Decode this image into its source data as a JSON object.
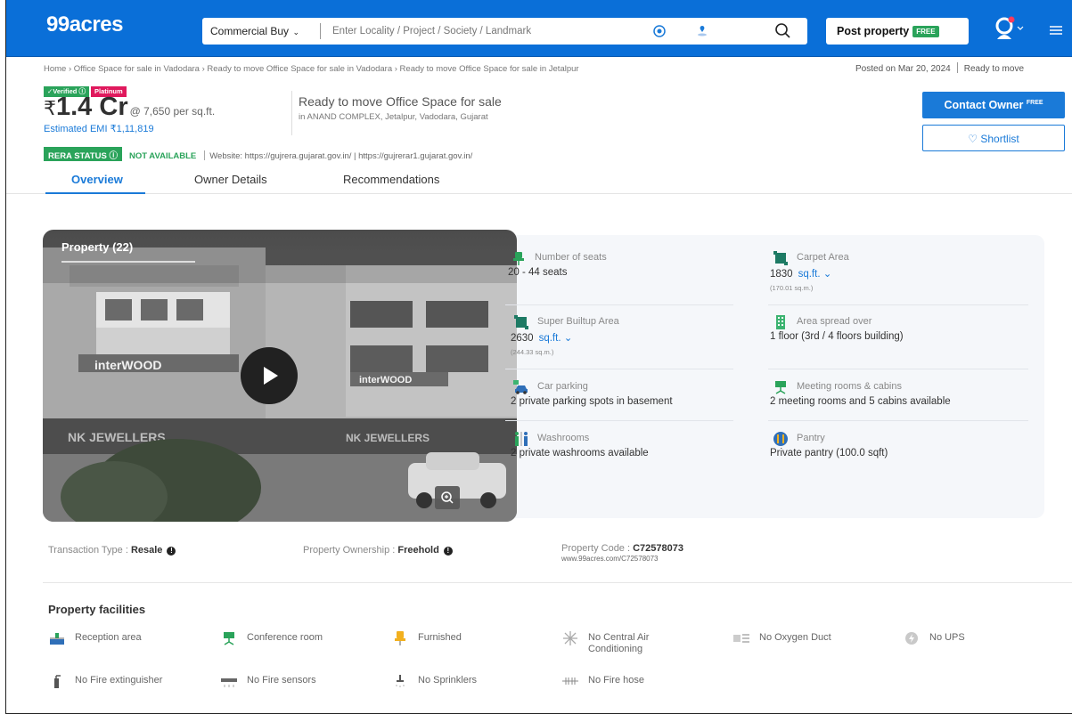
{
  "header": {
    "logo": "99acres",
    "category": "Commercial Buy",
    "search_placeholder": "Enter Locality / Project / Society / Landmark",
    "post_property": "Post property",
    "post_badge": "FREE",
    "brand_color": "#0a6fd8"
  },
  "breadcrumb": "Home › Office Space for sale in Vadodara › Ready to move Office Space for sale in Vadodara › Ready to move Office Space for sale in Jetalpur",
  "posted": {
    "date": "Posted on Mar 20, 2024",
    "status": "Ready to move"
  },
  "badges": {
    "verified": "✓Verified",
    "platinum": "Platinum"
  },
  "price": {
    "currency": "₹",
    "amount": "1.4 Cr",
    "per_sqft": "@ 7,650 per sq.ft.",
    "emi": "Estimated EMI ₹1,11,819"
  },
  "property": {
    "title": "Ready to move Office Space for sale",
    "address": "in ANAND COMPLEX, Jetalpur, Vadodara, Gujarat"
  },
  "actions": {
    "contact": "Contact Owner",
    "contact_badge": "FREE",
    "shortlist": "Shortlist"
  },
  "rera": {
    "label": "RERA STATUS",
    "status": "NOT AVAILABLE",
    "website": "Website: https://gujrera.gujarat.gov.in/",
    "website2": "https://gujrerar1.gujarat.gov.in/"
  },
  "tabs": [
    "Overview",
    "Owner Details",
    "Recommendations"
  ],
  "photo": {
    "title": "Property (22)"
  },
  "features": [
    {
      "label": "Number of seats",
      "value": "20 - 44 seats",
      "icon": "seat-icon"
    },
    {
      "label": "Carpet Area",
      "value": "1830",
      "unit": "sq.ft.",
      "sub": "(170.01 sq.m.)",
      "icon": "area-icon"
    },
    {
      "label": "Super Builtup Area",
      "value": "2630",
      "unit": "sq.ft.",
      "sub": "(244.33 sq.m.)",
      "icon": "builtup-icon"
    },
    {
      "label": "Area spread over",
      "value": "1 floor (3rd / 4 floors building)",
      "icon": "building-icon"
    },
    {
      "label": "Car parking",
      "value": "2 private parking spots in basement",
      "icon": "car-icon"
    },
    {
      "label": "Meeting rooms & cabins",
      "value": "2 meeting rooms and 5 cabins available",
      "icon": "meeting-icon"
    },
    {
      "label": "Washrooms",
      "value": "2 private washrooms available",
      "icon": "washroom-icon"
    },
    {
      "label": "Pantry",
      "value": "Private pantry (100.0 sqft)",
      "icon": "pantry-icon"
    }
  ],
  "transaction": {
    "label": "Transaction Type : ",
    "value": "Resale"
  },
  "ownership": {
    "label": "Property Ownership : ",
    "value": "Freehold"
  },
  "code": {
    "label": "Property Code : ",
    "value": "C72578073",
    "url": "www.99acres.com/C72578073"
  },
  "facilities": {
    "title": "Property facilities",
    "items": [
      "Reception area",
      "Conference room",
      "Furnished",
      "No Central Air Conditioning",
      "No Oxygen Duct",
      "No UPS",
      "No Fire extinguisher",
      "No Fire sensors",
      "No Sprinklers",
      "No Fire hose"
    ]
  }
}
